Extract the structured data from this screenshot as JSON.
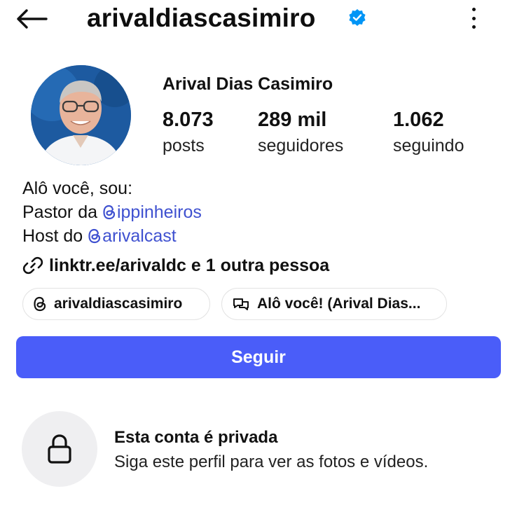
{
  "header": {
    "username": "arivaldiascasimiro",
    "verified": true,
    "back_icon": "arrow-left-icon",
    "more_icon": "more-vertical-icon"
  },
  "profile": {
    "full_name": "Arival Dias Casimiro",
    "stats": [
      {
        "value": "8.073",
        "label": "posts"
      },
      {
        "value": "289 mil",
        "label": "seguidores"
      },
      {
        "value": "1.062",
        "label": "seguindo"
      }
    ]
  },
  "bio": {
    "line1": "Alô você, sou:",
    "line2_prefix": "Pastor da ",
    "line2_mention": "ippinheiros",
    "line3_prefix": "Host do ",
    "line3_mention": "arivalcast"
  },
  "links": {
    "text": "linktr.ee/arivaldc e 1 outra pessoa"
  },
  "chips": [
    {
      "label": "arivaldiascasimiro",
      "icon": "threads-icon"
    },
    {
      "label": "Alô você! (Arival Dias...",
      "icon": "chat-bubbles-icon"
    }
  ],
  "actions": {
    "follow_label": "Seguir"
  },
  "private_notice": {
    "title": "Esta conta é privada",
    "subtitle": "Siga este perfil para ver as fotos e vídeos."
  },
  "colors": {
    "accent": "#4a5df9",
    "mention": "#3f51d0",
    "verified": "#0095f6"
  }
}
